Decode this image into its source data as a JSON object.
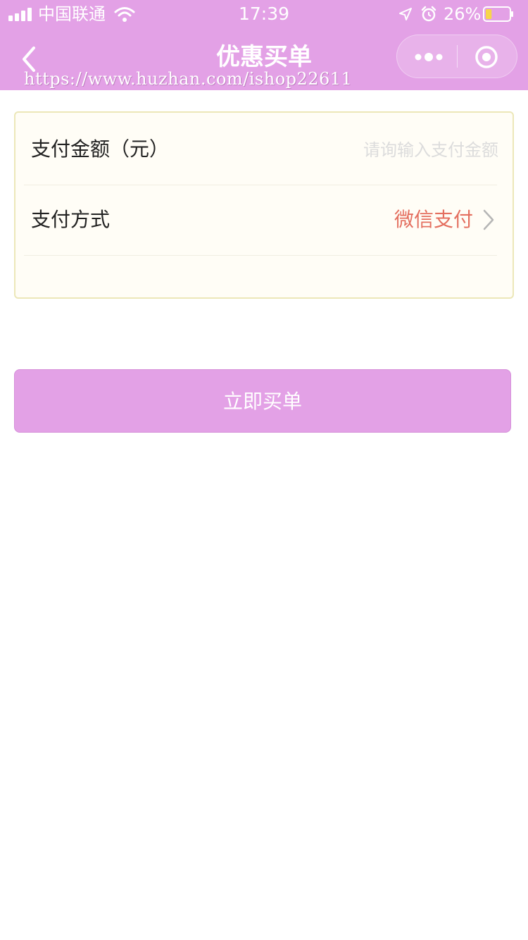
{
  "status_bar": {
    "carrier": "中国联通",
    "time": "17:39",
    "battery": "26%",
    "battery_level": 0.26,
    "icons": [
      "signal-icon",
      "wifi-icon",
      "location-icon",
      "alarm-icon",
      "battery-icon"
    ]
  },
  "nav": {
    "title": "优惠买单",
    "back_icon": "chevron-left-icon",
    "more_icon": "more-dots-icon",
    "close_icon": "target-circle-icon"
  },
  "watermark": "https://www.huzhan.com/ishop22611",
  "form": {
    "amount_label": "支付金额（元）",
    "amount_value": "",
    "amount_placeholder": "请询输入支付金额",
    "method_label": "支付方式",
    "method_value": "微信支付"
  },
  "submit_label": "立即买单",
  "colors": {
    "primary": "#e3a1e6",
    "accent_text": "#e46f5f",
    "card_border": "#ece7b8",
    "card_bg": "#fffdf6"
  }
}
